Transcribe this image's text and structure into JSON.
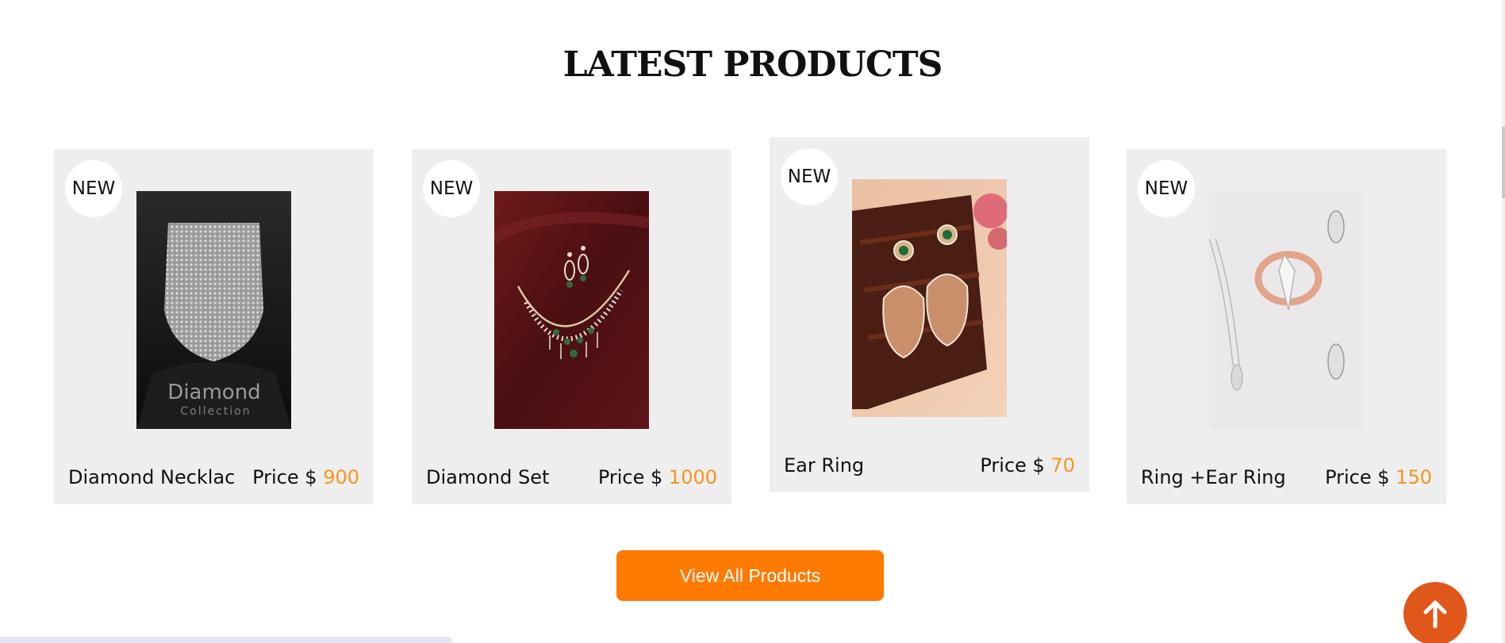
{
  "section": {
    "title": "LATEST PRODUCTS"
  },
  "products": [
    {
      "badge": "NEW",
      "name": "Diamond Necklac",
      "price_label": "Price $",
      "price_value": "900",
      "image_icon": "diamond-choker-image",
      "image_caption_line1": "Diamond",
      "image_caption_line2": "Collection"
    },
    {
      "badge": "NEW",
      "name": "Diamond Set",
      "price_label": "Price $",
      "price_value": "1000",
      "image_icon": "diamond-necklace-set-image"
    },
    {
      "badge": "NEW",
      "name": "Ear Ring",
      "price_label": "Price $",
      "price_value": "70",
      "image_icon": "jhumka-earrings-image"
    },
    {
      "badge": "NEW",
      "name": "Ring +Ear Ring",
      "price_label": "Price $",
      "price_value": "150",
      "image_icon": "ring-and-earrings-image"
    }
  ],
  "actions": {
    "view_all_label": "View All Products",
    "back_to_top_icon": "arrow-up-icon"
  },
  "colors": {
    "accent_orange": "#ff7a00",
    "price_orange": "#f7941d",
    "back_to_top": "#e0571a",
    "card_bg": "#eeeeee"
  }
}
